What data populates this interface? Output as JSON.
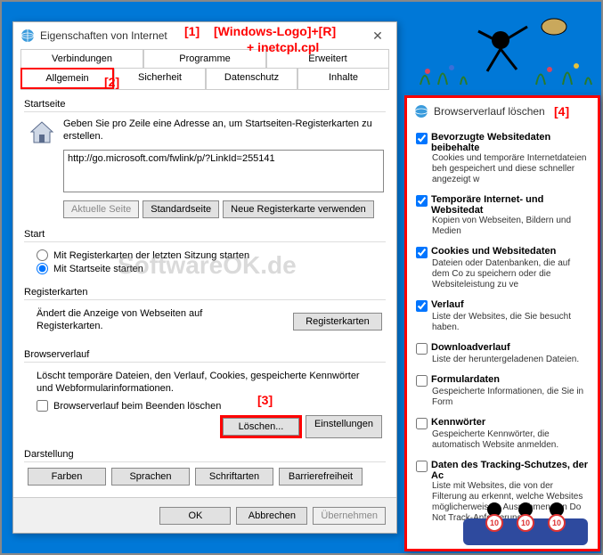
{
  "annotations": {
    "hotkey_line1": "[Windows-Logo]+[R]",
    "hotkey_line2": "+ inetcpl.cpl",
    "m1": "[1]",
    "m2": "[2]",
    "m3": "[3]",
    "m4": "[4]"
  },
  "watermark": "SoftwareOK.de",
  "main": {
    "title": "Eigenschaften von Internet",
    "tabs_row1": [
      "Verbindungen",
      "Programme",
      "Erweitert"
    ],
    "tabs_row2": [
      "Allgemein",
      "Sicherheit",
      "Datenschutz",
      "Inhalte"
    ],
    "startseite": {
      "label": "Startseite",
      "desc": "Geben Sie pro Zeile eine Adresse an, um Startseiten-Registerkarten zu erstellen.",
      "url": "http://go.microsoft.com/fwlink/p/?LinkId=255141",
      "btn_current": "Aktuelle Seite",
      "btn_default": "Standardseite",
      "btn_newtab": "Neue Registerkarte verwenden"
    },
    "start": {
      "label": "Start",
      "opt_last": "Mit Registerkarten der letzten Sitzung starten",
      "opt_home": "Mit Startseite starten"
    },
    "tabs_section": {
      "label": "Registerkarten",
      "desc": "Ändert die Anzeige von Webseiten auf Registerkarten.",
      "btn": "Registerkarten"
    },
    "history": {
      "label": "Browserverlauf",
      "desc": "Löscht temporäre Dateien, den Verlauf, Cookies, gespeicherte Kennwörter und Webformularinformationen.",
      "chk_exit": "Browserverlauf beim Beenden löschen",
      "btn_delete": "Löschen...",
      "btn_settings": "Einstellungen"
    },
    "appearance": {
      "label": "Darstellung",
      "btn_colors": "Farben",
      "btn_lang": "Sprachen",
      "btn_fonts": "Schriftarten",
      "btn_access": "Barrierefreiheit"
    },
    "buttons": {
      "ok": "OK",
      "cancel": "Abbrechen",
      "apply": "Übernehmen"
    }
  },
  "delete_dialog": {
    "title": "Browserverlauf löschen",
    "items": [
      {
        "checked": true,
        "label": "Bevorzugte Websitedaten beibehalte",
        "desc": "Cookies und temporäre Internetdateien beh gespeichert und diese schneller angezeigt w"
      },
      {
        "checked": true,
        "label": "Temporäre Internet- und Websitedat",
        "desc": "Kopien von Webseiten, Bildern und Medien"
      },
      {
        "checked": true,
        "label": "Cookies und Websitedaten",
        "desc": "Dateien oder Datenbanken, die auf dem Co zu speichern oder die Websiteleistung zu ve"
      },
      {
        "checked": true,
        "label": "Verlauf",
        "desc": "Liste der Websites, die Sie besucht haben."
      },
      {
        "checked": false,
        "label": "Downloadverlauf",
        "desc": "Liste der heruntergeladenen Dateien."
      },
      {
        "checked": false,
        "label": "Formulardaten",
        "desc": "Gespeicherte Informationen, die Sie in Form"
      },
      {
        "checked": false,
        "label": "Kennwörter",
        "desc": "Gespeicherte Kennwörter, die automatisch Website anmelden."
      },
      {
        "checked": false,
        "label": "Daten des Tracking-Schutzes, der Ac",
        "desc": "Liste mit Websites, die von der Filterung au erkennt, welche Websites möglicherweise a Ausnahmen von Do Not Track-Anforderung"
      }
    ]
  }
}
